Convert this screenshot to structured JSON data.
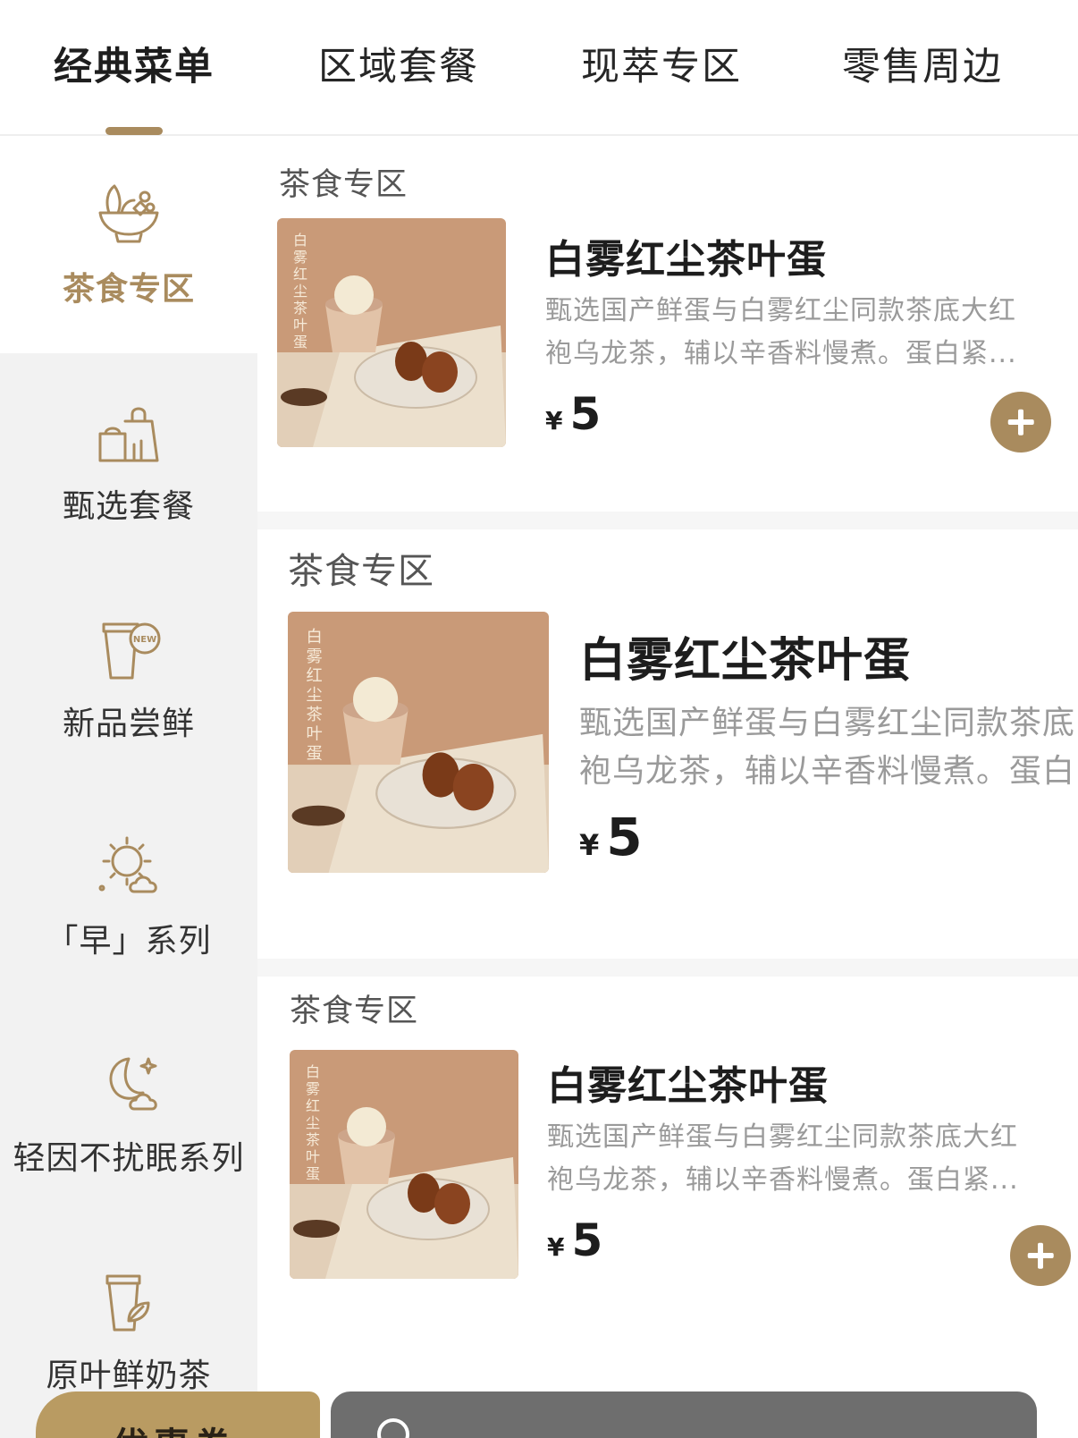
{
  "top_tabs": [
    {
      "label": "经典菜单",
      "active": true
    },
    {
      "label": "区域套餐",
      "active": false
    },
    {
      "label": "现萃专区",
      "active": false
    },
    {
      "label": "零售周边",
      "active": false
    }
  ],
  "sidebar": {
    "items": [
      {
        "label": "茶食专区",
        "icon": "salad-bowl-icon",
        "active": true
      },
      {
        "label": "甄选套餐",
        "icon": "shopping-bags-icon",
        "active": false
      },
      {
        "label": "新品尝鲜",
        "icon": "new-cup-icon",
        "active": false
      },
      {
        "label": "「早」系列",
        "icon": "sun-cloud-icon",
        "active": false
      },
      {
        "label": "轻因不扰眠系列",
        "icon": "moon-cloud-icon",
        "active": false
      },
      {
        "label": "原叶鲜奶茶",
        "icon": "leaf-cup-icon",
        "active": false
      }
    ]
  },
  "products": [
    {
      "section": "茶食专区",
      "name": "白雾红尘茶叶蛋",
      "desc_line1": "甄选国产鲜蛋与白雾红尘同款茶底大红",
      "desc_line2": "袍乌龙茶，辅以辛香料慢煮。蛋白紧...",
      "currency": "¥",
      "price": "5",
      "image_caption": "白雾红尘茶叶蛋"
    },
    {
      "section": "茶食专区",
      "name": "白雾红尘茶叶蛋",
      "desc_line1": "甄选国产鲜蛋与白雾红尘同款茶底",
      "desc_line2": "袍乌龙茶，辅以辛香料慢煮。蛋白",
      "currency": "¥",
      "price": "5",
      "image_caption": "白雾红尘茶叶蛋"
    },
    {
      "section": "茶食专区",
      "name": "白雾红尘茶叶蛋",
      "desc_line1": "甄选国产鲜蛋与白雾红尘同款茶底大红",
      "desc_line2": "袍乌龙茶，辅以辛香料慢煮。蛋白紧...",
      "currency": "¥",
      "price": "5",
      "image_caption": "白雾红尘茶叶蛋"
    }
  ],
  "bottom_bar": {
    "coupon_label": "优惠券"
  },
  "colors": {
    "accent": "#a98b5e",
    "sidebar_bg": "#f2f2f2",
    "cart_bar": "#6e6e6e"
  }
}
